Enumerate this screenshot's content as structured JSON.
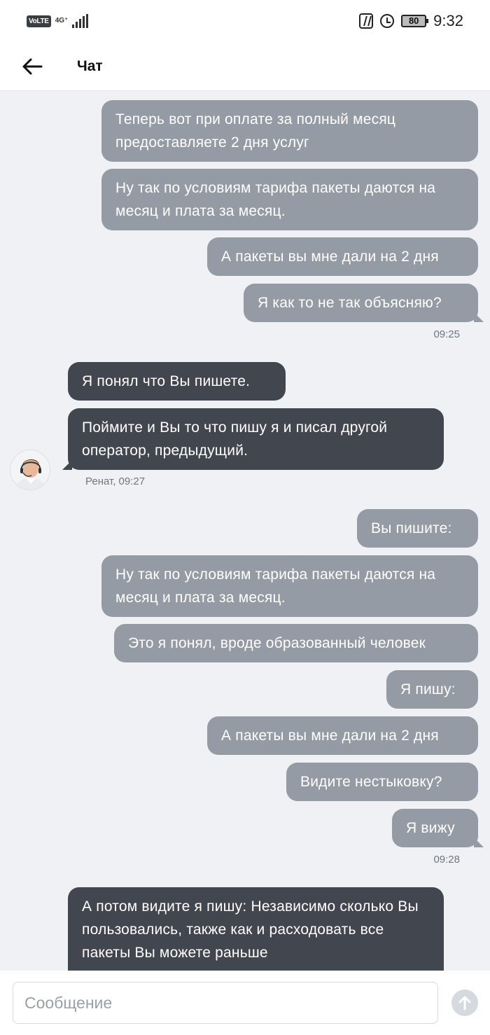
{
  "status_bar": {
    "volte": "VoLTE",
    "network": "4G⁺",
    "time": "9:32",
    "battery": "80"
  },
  "header": {
    "title": "Чат",
    "back_icon": "arrow-left-icon"
  },
  "messages": [
    {
      "side": "out",
      "text": "Теперь вот при оплате за полный месяц предоставляете 2 дня услуг"
    },
    {
      "side": "out",
      "text": "Ну так по условиям тарифа пакеты даются на месяц и плата за месяц."
    },
    {
      "side": "out",
      "text": "А пакеты вы мне дали на 2 дня"
    },
    {
      "side": "out",
      "text": "Я как то не так объясняю?"
    },
    {
      "side": "in",
      "text": "Я понял что Вы пишете."
    },
    {
      "side": "in",
      "text": "Поймите и Вы то что пишу я и писал другой оператор, предыдущий."
    },
    {
      "side": "out",
      "text": "Вы пишите:"
    },
    {
      "side": "out",
      "text": "Ну так по условиям тарифа пакеты даются на месяц и плата за месяц."
    },
    {
      "side": "out",
      "text": "Это я понял, вроде образованный человек"
    },
    {
      "side": "out",
      "text": "Я пишу:"
    },
    {
      "side": "out",
      "text": "А пакеты вы мне дали на 2 дня"
    },
    {
      "side": "out",
      "text": "Видите нестыковку?"
    },
    {
      "side": "out",
      "text": "Я вижу"
    },
    {
      "side": "in",
      "text": "А потом видите я пишу: Независимо сколько Вы пользовались, также как и расходовать все пакеты Вы можете раньше"
    }
  ],
  "timestamps": {
    "t1": "09:25",
    "t2": "Ренат, 09:27",
    "t3": "09:28"
  },
  "composer": {
    "placeholder": "Сообщение",
    "send_icon": "arrow-up-icon"
  }
}
